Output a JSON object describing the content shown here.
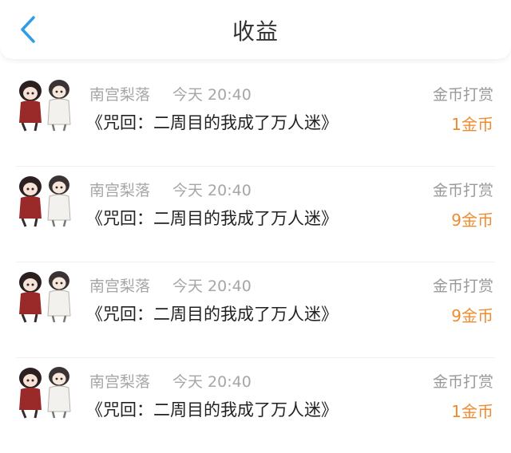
{
  "header": {
    "title": "收益"
  },
  "records": [
    {
      "user": "南宫梨落",
      "time": "今天 20:40",
      "book": "《咒回：二周目的我成了万人迷》",
      "type": "金币打赏",
      "amount": "1金币"
    },
    {
      "user": "南宫梨落",
      "time": "今天 20:40",
      "book": "《咒回：二周目的我成了万人迷》",
      "type": "金币打赏",
      "amount": "9金币"
    },
    {
      "user": "南宫梨落",
      "time": "今天 20:40",
      "book": "《咒回：二周目的我成了万人迷》",
      "type": "金币打赏",
      "amount": "9金币"
    },
    {
      "user": "南宫梨落",
      "time": "今天 20:40",
      "book": "《咒回：二周目的我成了万人迷》",
      "type": "金币打赏",
      "amount": "1金币"
    }
  ],
  "colors": {
    "back_icon": "#2e9de6",
    "amount": "#f08a2e"
  },
  "icons": {
    "back": "chevron-left-icon"
  }
}
